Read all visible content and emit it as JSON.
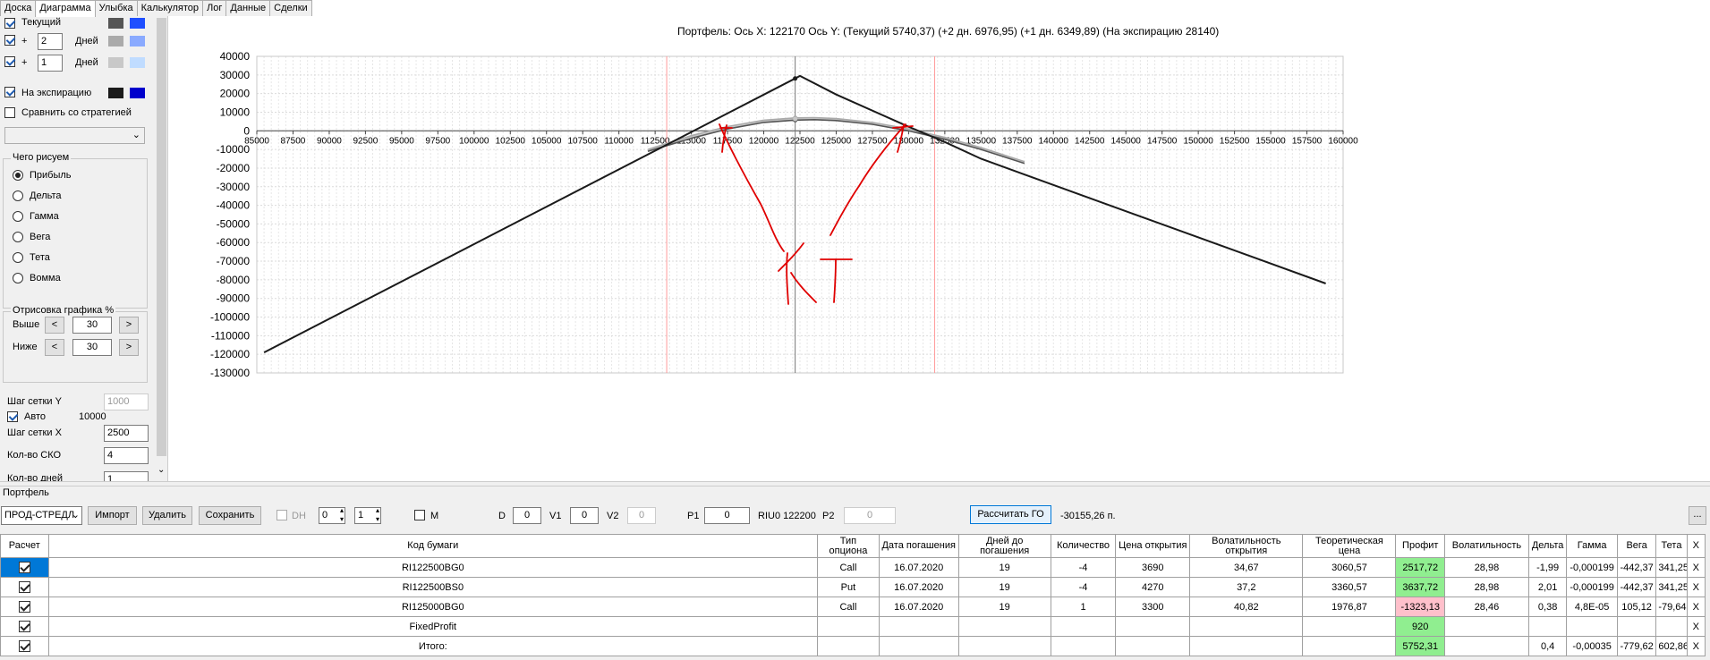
{
  "tabs": [
    "Доска",
    "Диаграмма",
    "Улыбка",
    "Калькулятор",
    "Лог",
    "Данные",
    "Сделки"
  ],
  "active_tab": "Диаграмма",
  "series_controls": {
    "current_label": "Текущий",
    "plus_label": "+",
    "days_label": "Дней",
    "days_2": "2",
    "days_1": "1",
    "expiry_label": "На экспирацию",
    "compare_label": "Сравнить со стратегией",
    "colors": {
      "current": [
        "#555555",
        "#1f4fff"
      ],
      "d2": [
        "#aaaaaa",
        "#8aaaff"
      ],
      "d1": [
        "#c8c8c8",
        "#c0dcff"
      ],
      "expiry": [
        "#1a1a1a",
        "#0000cc"
      ]
    }
  },
  "draw_group": {
    "title": "Чего рисуем",
    "options": [
      "Прибыль",
      "Дельта",
      "Гамма",
      "Вега",
      "Тета",
      "Вомма"
    ],
    "selected": "Прибыль"
  },
  "render_group": {
    "title": "Отрисовка графика %",
    "above_label": "Выше",
    "below_label": "Ниже",
    "above": "30",
    "below": "30",
    "dec": "<",
    "inc": ">"
  },
  "grid_settings": {
    "y_step_label": "Шаг сетки Y",
    "y_step": "1000",
    "auto_label": "Авто",
    "auto_value": "10000",
    "x_step_label": "Шаг сетки X",
    "x_step": "2500",
    "sko_label": "Кол-во СКО",
    "sko": "4",
    "days_label": "Кол-во дней",
    "days": "1"
  },
  "chart_header": "Портфель: Ось X: 122170 Ось Y:  (Текущий 5740,37)  (+2 дн. 6976,95)  (+1 дн. 6349,89)  (На экспирацию 28140)",
  "chart_data": {
    "type": "line",
    "xlim": [
      85000,
      160000
    ],
    "ylim": [
      -130000,
      40000
    ],
    "x_ticks": [
      85000,
      87500,
      90000,
      92500,
      95000,
      97500,
      100000,
      102500,
      105000,
      107500,
      110000,
      112500,
      115000,
      117500,
      120000,
      122500,
      125000,
      127500,
      130000,
      132500,
      135000,
      137500,
      140000,
      142500,
      145000,
      147500,
      150000,
      152500,
      155000,
      157500,
      160000
    ],
    "y_ticks": [
      40000,
      30000,
      20000,
      10000,
      0,
      -10000,
      -20000,
      -30000,
      -40000,
      -50000,
      -60000,
      -70000,
      -80000,
      -90000,
      -100000,
      -110000,
      -120000,
      -130000
    ],
    "cursor_x": 122170,
    "vertical_lines": [
      113300,
      131800
    ],
    "series": [
      {
        "color": "#1a1a1a",
        "points": [
          [
            85500,
            -119000
          ],
          [
            122170,
            28140
          ],
          [
            122500,
            29500
          ],
          [
            125000,
            19500
          ],
          [
            130000,
            2200
          ],
          [
            132500,
            -6000
          ],
          [
            135000,
            -15000
          ],
          [
            158800,
            -82000
          ]
        ]
      },
      {
        "color": "#555555",
        "points": [
          [
            112000,
            -11000
          ],
          [
            115000,
            -4000
          ],
          [
            117500,
            1000
          ],
          [
            120000,
            4500
          ],
          [
            122170,
            5740
          ],
          [
            123500,
            6000
          ],
          [
            125000,
            5500
          ],
          [
            127500,
            3500
          ],
          [
            130000,
            0
          ],
          [
            132500,
            -4500
          ],
          [
            135000,
            -10000
          ],
          [
            138000,
            -17500
          ]
        ]
      },
      {
        "color": "#aaaaaa",
        "points": [
          [
            112000,
            -10000
          ],
          [
            115000,
            -2600
          ],
          [
            117500,
            2300
          ],
          [
            120000,
            5700
          ],
          [
            122170,
            6977
          ],
          [
            123500,
            7100
          ],
          [
            125000,
            6600
          ],
          [
            127500,
            4500
          ],
          [
            130000,
            1000
          ],
          [
            132500,
            -3500
          ],
          [
            135000,
            -9000
          ],
          [
            138000,
            -16500
          ]
        ]
      },
      {
        "color": "#c8c8c8",
        "points": [
          [
            112000,
            -10500
          ],
          [
            115000,
            -3300
          ],
          [
            117500,
            1600
          ],
          [
            120000,
            5100
          ],
          [
            122170,
            6350
          ],
          [
            123500,
            6500
          ],
          [
            125000,
            6000
          ],
          [
            127500,
            4000
          ],
          [
            130000,
            500
          ],
          [
            132500,
            -4000
          ],
          [
            135000,
            -9500
          ],
          [
            138000,
            -17000
          ]
        ]
      }
    ],
    "annotation": "КТ"
  },
  "portfolio": {
    "title": "Портфель",
    "select_value": "ПРОД-СТРЕДЛ",
    "import": "Импорт",
    "delete": "Удалить",
    "save": "Сохранить",
    "dh": "DH",
    "spin1": "0",
    "spin2": "1",
    "m": "M",
    "d_label": "D",
    "d": "0",
    "v1_label": "V1",
    "v1": "0",
    "v2_label": "V2",
    "v2": "0",
    "p1_label": "P1",
    "p1": "0",
    "riu": "RIU0 122200",
    "p2_label": "P2",
    "p2": "0",
    "calc_go": "Рассчитать ГО",
    "go_value": "-30155,26 п.",
    "more": "..."
  },
  "table": {
    "headers": [
      "Расчет",
      "Код бумаги",
      "Тип опциона",
      "Дата погашения",
      "Дней до погашения",
      "Количество",
      "Цена открытия",
      "Волатильность открытия",
      "Теоретическая цена",
      "Профит",
      "Волатильность",
      "Дельта",
      "Гамма",
      "Вега",
      "Тета",
      "X"
    ],
    "rows": [
      [
        "RI122500BG0",
        "Call",
        "16.07.2020",
        "19",
        "-4",
        "3690",
        "34,67",
        "3060,57",
        "2517,72",
        "28,98",
        "-1,99",
        "-0,000199",
        "-442,37",
        "341,25",
        "X"
      ],
      [
        "RI122500BS0",
        "Put",
        "16.07.2020",
        "19",
        "-4",
        "4270",
        "37,2",
        "3360,57",
        "3637,72",
        "28,98",
        "2,01",
        "-0,000199",
        "-442,37",
        "341,25",
        "X"
      ],
      [
        "RI125000BG0",
        "Call",
        "16.07.2020",
        "19",
        "1",
        "3300",
        "40,82",
        "1976,87",
        "-1323,13",
        "28,46",
        "0,38",
        "4,8E-05",
        "105,12",
        "-79,64",
        "X"
      ],
      [
        "FixedProfit",
        "",
        "",
        "",
        "",
        "",
        "",
        "",
        "920",
        "",
        "",
        "",
        "",
        "",
        "X"
      ],
      [
        "Итого:",
        "",
        "",
        "",
        "",
        "",
        "",
        "",
        "5752,31",
        "",
        "0,4",
        "-0,00035",
        "-779,62",
        "602,86",
        "X"
      ]
    ]
  }
}
